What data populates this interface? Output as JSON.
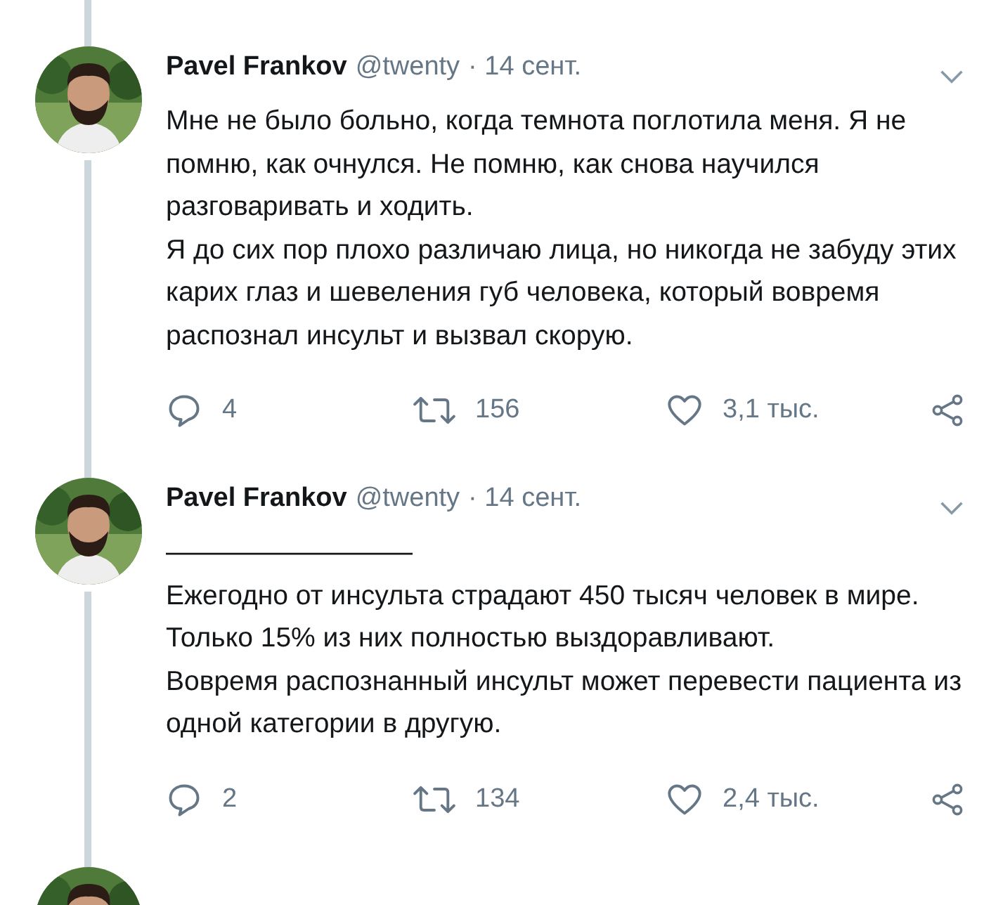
{
  "tweets": [
    {
      "author": "Pavel Frankov",
      "handle": "@twenty",
      "date": "· 14 сент.",
      "paragraphs": [
        "Мне не было больно, когда темнота поглотила меня. Я не помню, как очнулся. Не помню, как снова научился разговаривать и ходить.",
        "Я до сих пор плохо различаю лица, но никогда не забуду этих карих глаз и шевеления губ человека, который вовремя распознал инсульт и вызвал скорую."
      ],
      "replies": "4",
      "retweets": "156",
      "likes": "3,1 тыс."
    },
    {
      "author": "Pavel Frankov",
      "handle": "@twenty",
      "date": "· 14 сент.",
      "paragraphs": [
        "—————————",
        "Ежегодно от инсульта страдают 450 тысяч человек в мире. Только 15% из них полностью выздоравливают.",
        "Вовремя распознанный инсульт может перевести пациента из одной категории в другую."
      ],
      "replies": "2",
      "retweets": "134",
      "likes": "2,4 тыс."
    }
  ]
}
